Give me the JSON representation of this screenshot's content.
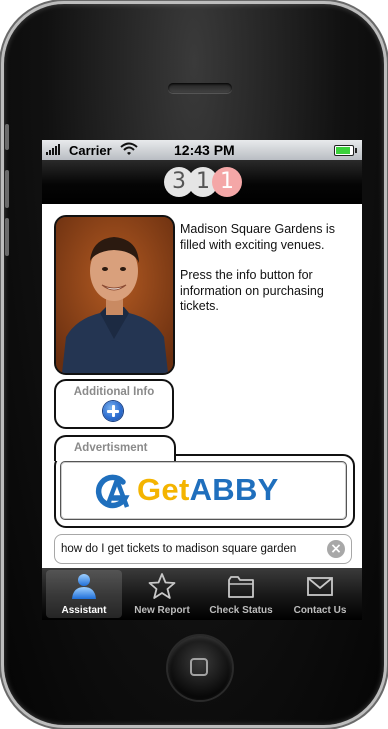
{
  "status_bar": {
    "carrier": "Carrier",
    "time": "12:43 PM",
    "signal_icon": "signal-bars-icon",
    "wifi_icon": "wifi-icon",
    "battery_icon": "battery-icon",
    "battery_level": 0.9,
    "battery_color": "#3bd13b"
  },
  "nav_bar": {
    "logo_digits": [
      "3",
      "1",
      "1"
    ],
    "logo_colors": [
      "#e5e5e5",
      "#e5e5e5",
      "#f4a7a7"
    ]
  },
  "assistant": {
    "avatar_icon": "assistant-photo",
    "message_paragraphs": [
      "Madison Square Gardens is filled with exciting venues.",
      "Press the info button for information on purchasing tickets."
    ]
  },
  "additional_info": {
    "label": "Additional Info",
    "button_icon": "plus-circle-icon"
  },
  "advertisement": {
    "tab_label": "Advertisment",
    "banner": {
      "brand_first": "Get",
      "brand_second": "ABBY",
      "brand_first_color": "#f4b400",
      "brand_second_color": "#1f6fbd",
      "logo_icon": "getabby-logo-icon"
    }
  },
  "search": {
    "value": "how do I get tickets to madison square garden",
    "placeholder": "",
    "clear_icon": "clear-icon"
  },
  "tab_bar": {
    "tabs": [
      {
        "label": "Assistant",
        "icon": "assistant-icon",
        "active": true
      },
      {
        "label": "New Report",
        "icon": "star-icon",
        "active": false
      },
      {
        "label": "Check Status",
        "icon": "folder-icon",
        "active": false
      },
      {
        "label": "Contact Us",
        "icon": "envelope-icon",
        "active": false
      }
    ]
  },
  "device": {
    "home_icon": "home-button-icon",
    "speaker_icon": "speaker-grille"
  }
}
